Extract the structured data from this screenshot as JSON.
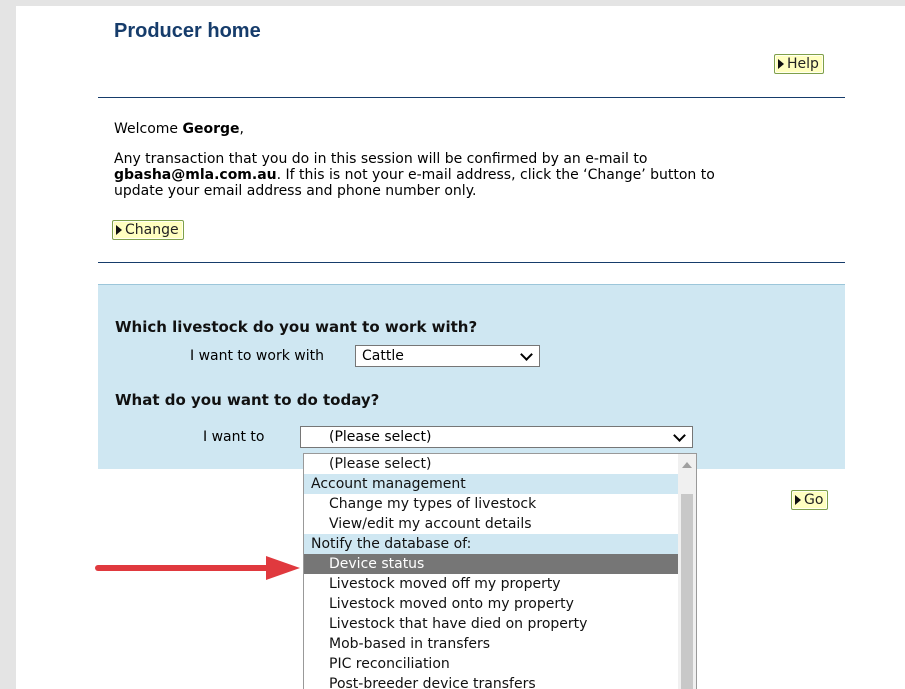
{
  "page": {
    "title": "Producer home",
    "help_label": "Help",
    "welcome_prefix": "Welcome ",
    "user_name": "George",
    "welcome_suffix": ",",
    "info_line1": "Any transaction that you do in this session will be confirmed by an e-mail to",
    "email": "gbasha@mla.com.au",
    "info_line2_rest": ". If this is not your e-mail address, click the ‘Change’ button to",
    "info_line3": "update your email address and phone number only.",
    "change_label": "Change"
  },
  "livestock": {
    "question": "Which livestock do you want to work with?",
    "label": "I want to work with",
    "selected": "Cattle"
  },
  "action": {
    "question": "What do you want to do today?",
    "label": "I want to",
    "selected": "(Please select)",
    "go_label": "Go"
  },
  "dropdown_options": [
    {
      "label": "(Please select)",
      "type": "option"
    },
    {
      "label": "Account management",
      "type": "group"
    },
    {
      "label": "Change my types of livestock",
      "type": "option"
    },
    {
      "label": "View/edit my account details",
      "type": "option"
    },
    {
      "label": "Notify the database of:",
      "type": "group"
    },
    {
      "label": "Device status",
      "type": "option",
      "highlighted": true
    },
    {
      "label": "Livestock moved off my property",
      "type": "option"
    },
    {
      "label": "Livestock moved onto my property",
      "type": "option"
    },
    {
      "label": "Livestock that have died on property",
      "type": "option"
    },
    {
      "label": "Mob-based in transfers",
      "type": "option"
    },
    {
      "label": "PIC reconciliation",
      "type": "option"
    },
    {
      "label": "Post-breeder device transfers",
      "type": "option"
    }
  ],
  "colors": {
    "title": "#163c6b",
    "button_bg": "#ffffc0",
    "panel_bg": "#cfe7f2",
    "highlight": "#767676",
    "annotation_arrow": "#e0393e"
  }
}
